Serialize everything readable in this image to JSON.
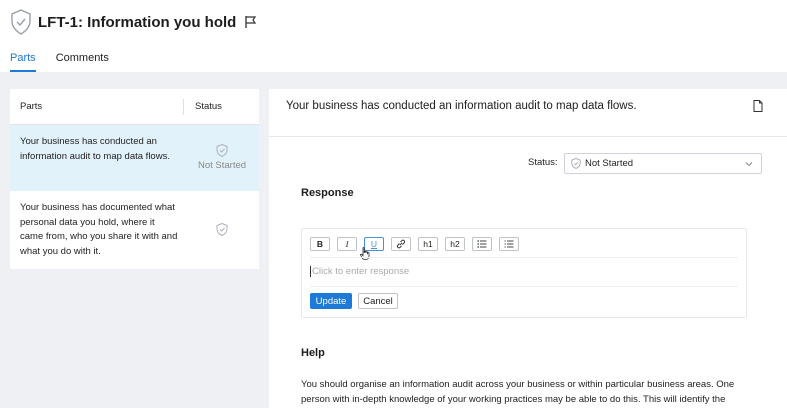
{
  "header": {
    "title": "LFT-1: Information you hold"
  },
  "tabs": [
    {
      "label": "Parts",
      "active": true
    },
    {
      "label": "Comments",
      "active": false
    }
  ],
  "parts_panel": {
    "columns": {
      "parts": "Parts",
      "status": "Status"
    },
    "rows": [
      {
        "text": "Your business has conducted an information audit to map data flows.",
        "status": "Not Started",
        "selected": true
      },
      {
        "text": "Your business has documented what personal data you hold, where it came from, who you share it with and what you do with it.",
        "status": "",
        "selected": false
      }
    ]
  },
  "detail": {
    "title": "Your business has conducted an information audit to map data flows.",
    "status_label": "Status:",
    "status_value": "Not Started",
    "response_heading": "Response",
    "editor": {
      "toolbar": [
        "B",
        "I",
        "U",
        "link",
        "h1",
        "h2",
        "bullet-list",
        "numbered-list"
      ],
      "placeholder": "Click to enter response",
      "update_label": "Update",
      "cancel_label": "Cancel"
    },
    "help_heading": "Help",
    "help_text": "You should organise an information audit across your business or within particular business areas. One person with in-depth knowledge of your working practices may be able to do this. This will identify the"
  },
  "colors": {
    "accent": "#1d7ad6",
    "selected_row": "#e2f2fb",
    "background": "#eef0f4"
  }
}
